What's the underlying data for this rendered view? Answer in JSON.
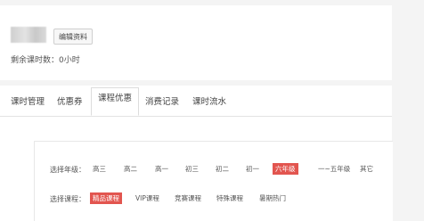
{
  "profile": {
    "edit_button": "编辑资料",
    "remaining_hours": "剩余课时数：0小时"
  },
  "tabs": [
    {
      "label": "课时管理",
      "active": false
    },
    {
      "label": "优惠券",
      "active": false
    },
    {
      "label": "课程优惠",
      "active": true
    },
    {
      "label": "消费记录",
      "active": false
    },
    {
      "label": "课时流水",
      "active": false
    }
  ],
  "filters": {
    "grade": {
      "label": "选择年级：",
      "options": [
        "高三",
        "高二",
        "高一",
        "初三",
        "初二",
        "初一",
        "六年级",
        "一~五年级",
        "其它"
      ],
      "selected": "六年级"
    },
    "course": {
      "label": "选择课程：",
      "options": [
        "精品课程",
        "VIP课程",
        "竞赛课程",
        "特殊课程",
        "暑期热门"
      ],
      "selected": "精品课程"
    }
  },
  "colors": {
    "accent": "#e2554f",
    "background": "#f4f4f4",
    "panel": "#ffffff"
  }
}
